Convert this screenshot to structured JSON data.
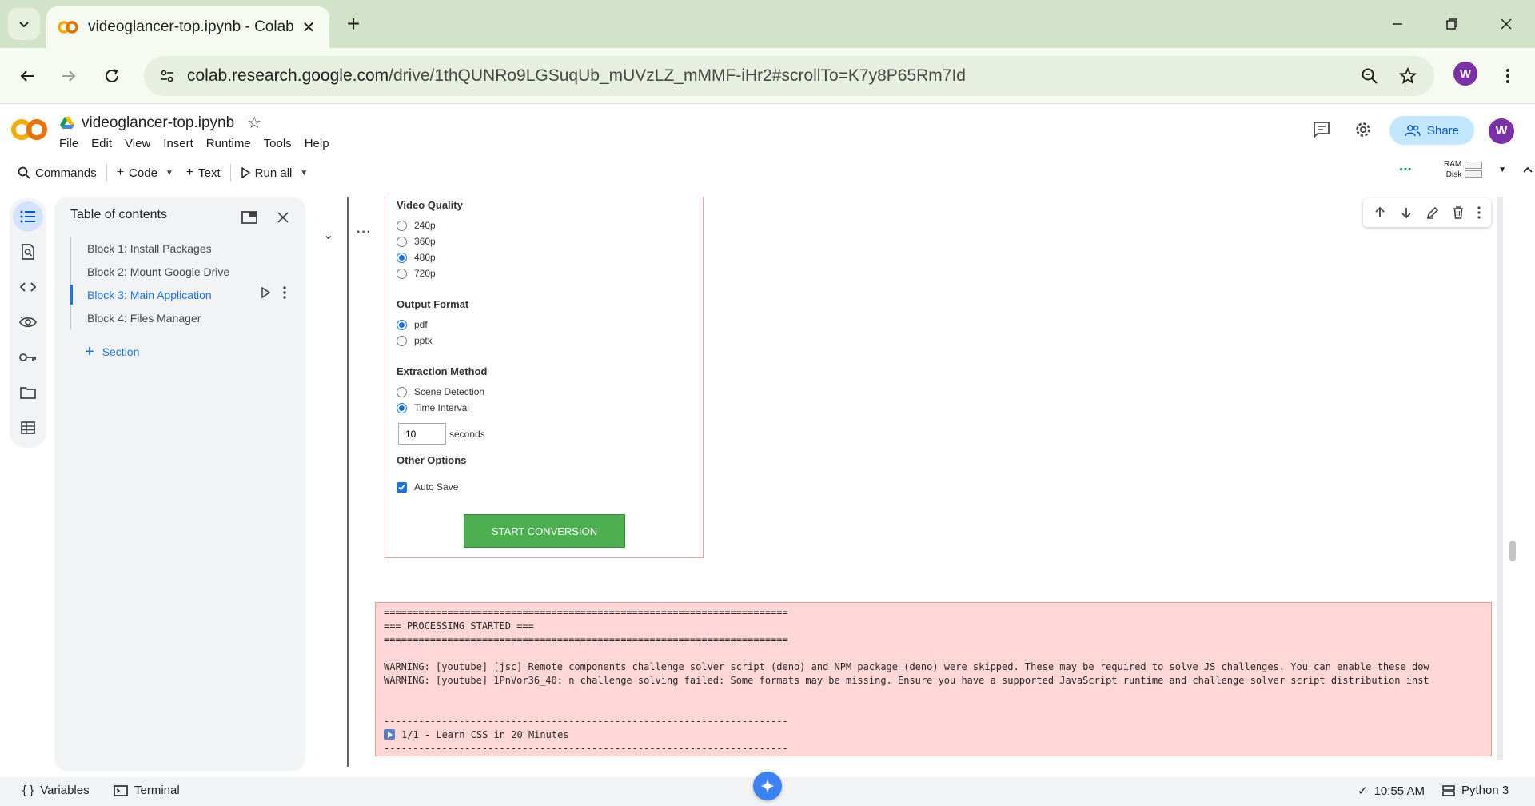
{
  "browser": {
    "tab_title": "videoglancer-top.ipynb - Colab",
    "new_tab": "+",
    "url_host": "colab.research.google.com",
    "url_rest": "/drive/1thQUNRo9LGSuqUb_mUVzLZ_mMMF-iHr2#scrollTo=K7y8P65Rm7Id",
    "profile_initial": "W"
  },
  "colab": {
    "notebook_title": "videoglancer-top.ipynb",
    "menu": [
      "File",
      "Edit",
      "View",
      "Insert",
      "Runtime",
      "Tools",
      "Help"
    ],
    "share_label": "Share",
    "account_initial": "W",
    "toolbar": {
      "commands": "Commands",
      "code": "Code",
      "text": "Text",
      "run_all": "Run all",
      "ram": "RAM",
      "disk": "Disk"
    }
  },
  "toc": {
    "title": "Table of contents",
    "items": [
      {
        "label": "Block 1: Install Packages"
      },
      {
        "label": "Block 2: Mount Google Drive"
      },
      {
        "label": "Block 3: Main Application"
      },
      {
        "label": "Block 4: Files Manager"
      }
    ],
    "section_label": "Section"
  },
  "form": {
    "video_quality_title": "Video Quality",
    "video_quality_options": [
      "240p",
      "360p",
      "480p",
      "720p"
    ],
    "video_quality_selected": "480p",
    "output_format_title": "Output Format",
    "output_format_options": [
      "pdf",
      "pptx"
    ],
    "output_format_selected": "pdf",
    "extraction_title": "Extraction Method",
    "extraction_options": [
      "Scene Detection",
      "Time Interval"
    ],
    "extraction_selected": "Time Interval",
    "interval_value": "10",
    "interval_unit": "seconds",
    "other_title": "Other Options",
    "auto_save_label": "Auto Save",
    "auto_save_checked": true,
    "start_button": "START CONVERSION"
  },
  "output": {
    "lines": [
      "======================================================================",
      "=== PROCESSING STARTED ===",
      "======================================================================",
      "",
      "WARNING: [youtube] [jsc] Remote components challenge solver script (deno) and NPM package (deno) were skipped. These may be required to solve JS challenges. You can enable these dow",
      "WARNING: [youtube] 1PnVor36_40: n challenge solving failed: Some formats may be missing. Ensure you have a supported JavaScript runtime and challenge solver script distribution inst",
      "",
      "",
      "----------------------------------------------------------------------",
      "1/1 - Learn CSS in 20 Minutes",
      "----------------------------------------------------------------------"
    ]
  },
  "statusbar": {
    "variables": "Variables",
    "terminal": "Terminal",
    "time": "10:55 AM",
    "runtime": "Python 3"
  },
  "colors": {
    "accent": "#1a73e8",
    "start_button": "#4caf50",
    "output_bg": "#ffd7d7",
    "chrome_bg": "#d3e3c9"
  }
}
